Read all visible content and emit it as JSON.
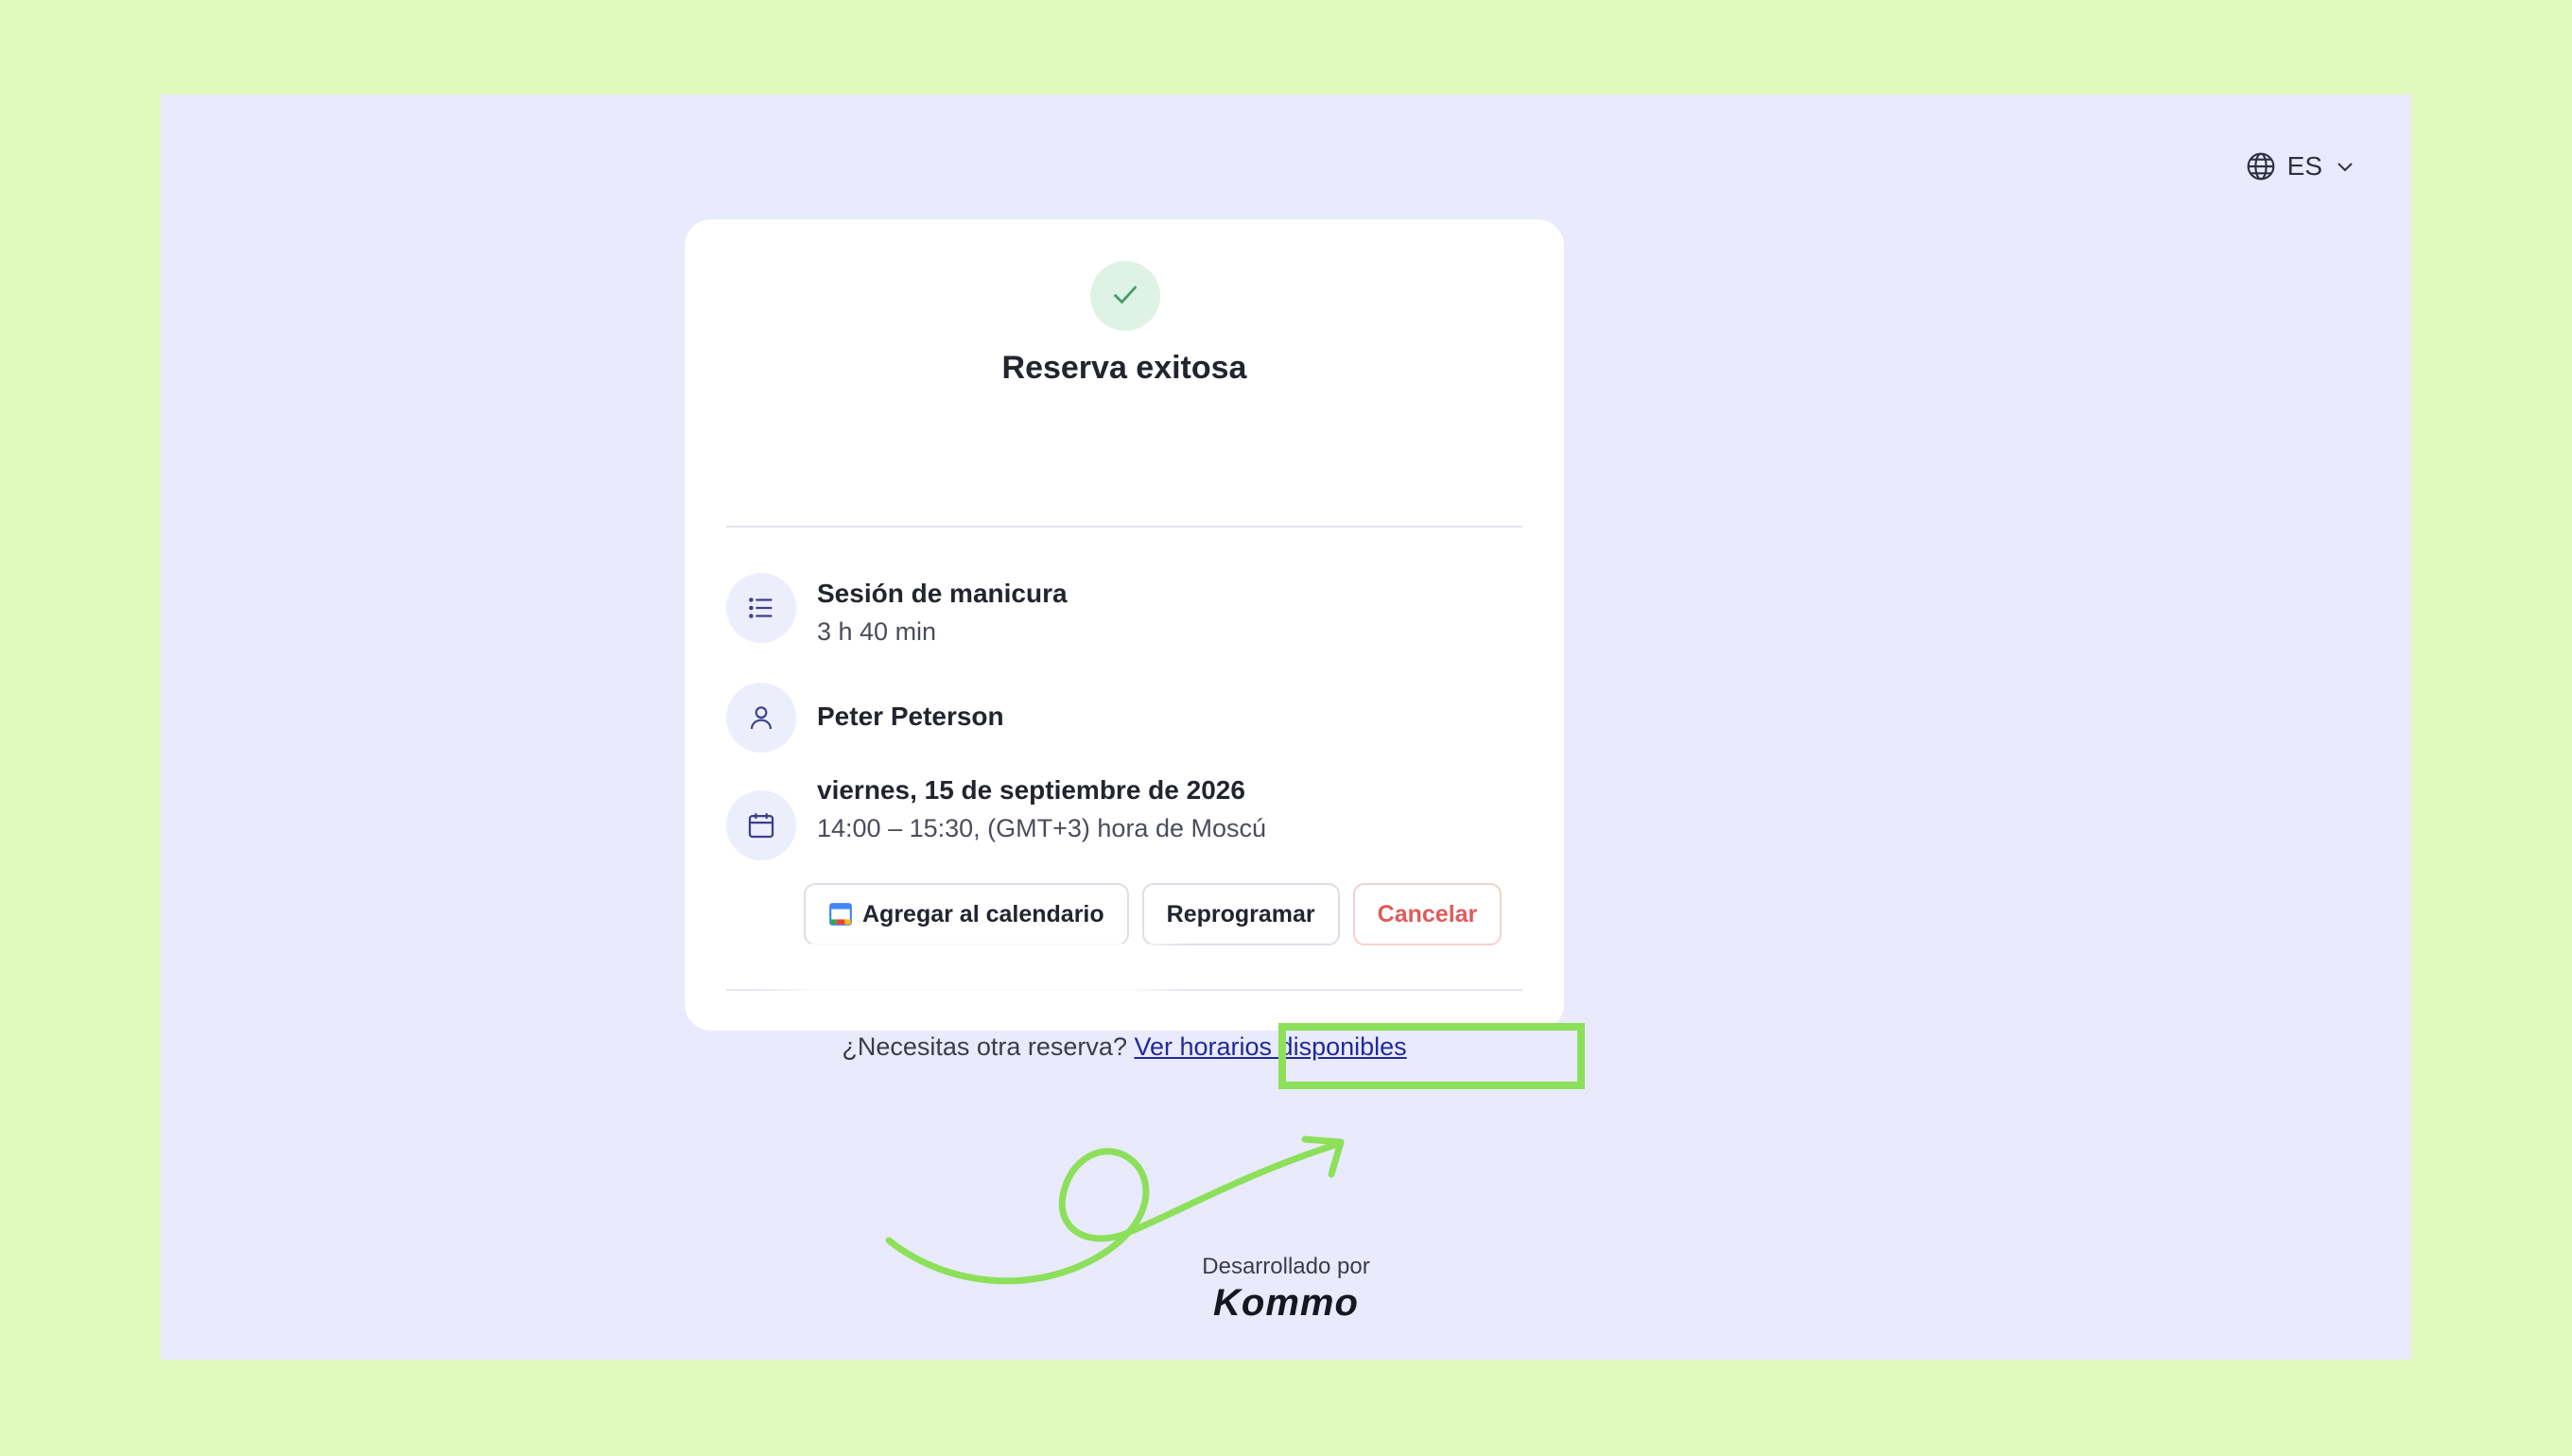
{
  "language": {
    "code": "ES"
  },
  "booking": {
    "title": "Reserva exitosa",
    "service": {
      "name": "Sesión de manicura",
      "duration": "3 h 40 min"
    },
    "staff": {
      "name": "Peter Peterson"
    },
    "datetime": {
      "date": "viernes, 15 de septiembre de 2026",
      "time": "14:00 – 15:30, (GMT+3) hora de Moscú"
    },
    "actions": {
      "add_calendar": "Agregar al calendario",
      "reschedule": "Reprogramar",
      "cancel": "Cancelar"
    },
    "footer": {
      "question": "¿Necesitas otra reserva?",
      "link": "Ver horarios disponibles"
    }
  },
  "credits": {
    "label": "Desarrollado por",
    "brand": "Kommo"
  },
  "colors": {
    "page_background": "#e0f9bc",
    "frame_background": "#e9eafc",
    "highlight": "#8ce05a",
    "cancel_text": "#e05a5a",
    "link": "#1f2a9c"
  },
  "icons": {
    "language": "globe-icon",
    "language_caret": "chevron-down-icon",
    "success": "check-icon",
    "service": "list-icon",
    "staff": "user-icon",
    "datetime": "calendar-icon",
    "add_calendar": "google-calendar-icon",
    "annotation": "curved-arrow-icon"
  }
}
